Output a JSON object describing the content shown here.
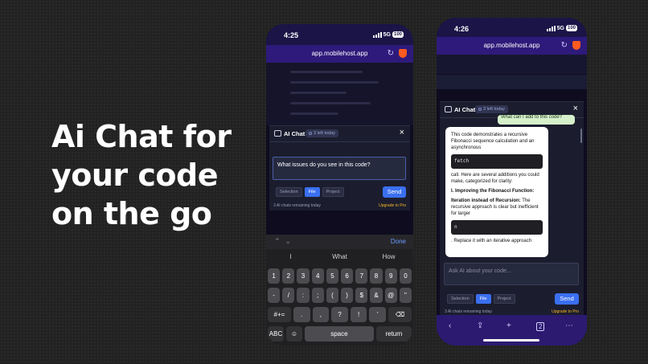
{
  "headline": {
    "line1": "Ai Chat for",
    "line2": "your code",
    "line3": "on the go"
  },
  "phone1": {
    "time": "4:25",
    "network": "5G",
    "battery": "100",
    "url": "app.mobilehost.app",
    "chat": {
      "title": "AI Chat",
      "badge": "3 left today",
      "input_value": "What issues do you see in this code?",
      "scope": [
        "Selection",
        "File",
        "Project"
      ],
      "send_label": "Send",
      "remaining": "3 AI chats remaining today",
      "upgrade": "Upgrade to Pro"
    },
    "keyboard": {
      "done": "Done",
      "suggestions": [
        "I",
        "What",
        "How"
      ],
      "row1": [
        "1",
        "2",
        "3",
        "4",
        "5",
        "6",
        "7",
        "8",
        "9",
        "0"
      ],
      "row2": [
        "-",
        "/",
        ":",
        ";",
        "(",
        ")",
        "$",
        "&",
        "@",
        "\""
      ],
      "row3_mid": [
        ".",
        ",",
        "?",
        "!",
        "'"
      ],
      "row3_left": "#+=",
      "abc": "ABC",
      "space": "space",
      "return": "return"
    }
  },
  "phone2": {
    "time": "4:26",
    "network": "5G",
    "battery": "100",
    "url": "app.mobilehost.app",
    "chat": {
      "title": "AI Chat",
      "badge": "3 left today",
      "user_message": "What can I add to this code?",
      "reply_intro": "This code demonstrates a recursive Fibonacci sequence calculation and an asynchronous",
      "code1": "fetch",
      "reply_mid": "call. Here are several additions you could make, categorized for clarity:",
      "heading1": "I. Improving the Fibonacci Function:",
      "heading2": "Iteration instead of Recursion:",
      "reply_iter": "The recursive approach is clear but inefficient for larger",
      "code2": "n",
      "reply_tail": ". Replace it with an iterative approach",
      "placeholder": "Ask AI about your code...",
      "scope": [
        "Selection",
        "File",
        "Project"
      ],
      "send_label": "Send",
      "remaining": "3 AI chats remaining today",
      "upgrade": "Upgrade to Pro"
    }
  },
  "colors": {
    "accent": "#3a6ff0",
    "upgrade": "#f5b625",
    "browser_bar": "#2e1a7a"
  }
}
